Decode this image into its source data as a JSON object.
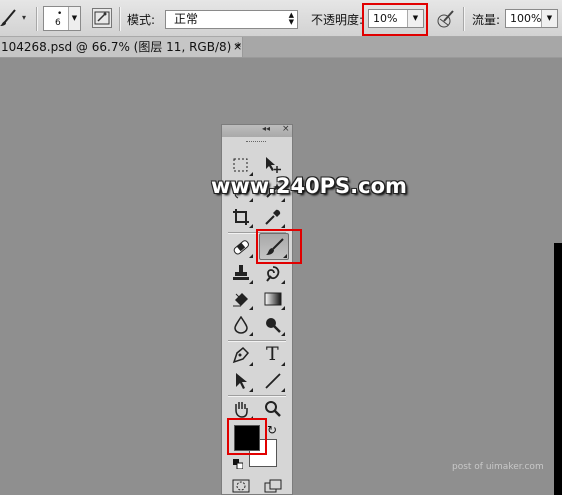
{
  "options_bar": {
    "tool_icon": "brush-icon",
    "brush_size": "6",
    "mode_label": "模式:",
    "mode_value": "正常",
    "opacity_label": "不透明度:",
    "opacity_value": "10%",
    "flow_label": "流量:",
    "flow_value": "100%"
  },
  "document_tab": {
    "title": "104268.psd @ 66.7% (图层 11, RGB/8) *",
    "close": "×"
  },
  "tools_panel": {
    "collapse": "◂◂",
    "close": "×",
    "tools": [
      {
        "name": "rect-marquee-tool",
        "icon": "marquee-icon"
      },
      {
        "name": "move-tool",
        "icon": "move-icon"
      },
      {
        "name": "lasso-tool",
        "icon": "lasso-icon"
      },
      {
        "name": "magic-wand-tool",
        "icon": "magic-wand-icon"
      },
      {
        "name": "crop-tool",
        "icon": "crop-icon"
      },
      {
        "name": "eyedropper-tool",
        "icon": "eyedropper-icon"
      },
      {
        "name": "healing-brush-tool",
        "icon": "bandage-icon"
      },
      {
        "name": "brush-tool",
        "icon": "brush-icon",
        "active": true
      },
      {
        "name": "clone-stamp-tool",
        "icon": "stamp-icon"
      },
      {
        "name": "history-brush-tool",
        "icon": "history-brush-icon"
      },
      {
        "name": "eraser-tool",
        "icon": "eraser-icon"
      },
      {
        "name": "gradient-tool",
        "icon": "gradient-icon"
      },
      {
        "name": "blur-tool",
        "icon": "drop-icon"
      },
      {
        "name": "dodge-tool",
        "icon": "dodge-icon"
      },
      {
        "name": "pen-tool",
        "icon": "pen-icon"
      },
      {
        "name": "type-tool",
        "icon": "type-icon",
        "glyph": "T"
      },
      {
        "name": "path-selection-tool",
        "icon": "arrow-icon"
      },
      {
        "name": "line-tool",
        "icon": "line-icon"
      },
      {
        "name": "hand-tool",
        "icon": "hand-icon"
      },
      {
        "name": "zoom-tool",
        "icon": "zoom-icon"
      },
      {
        "name": "quick-mask",
        "icon": "quick-mask-icon"
      },
      {
        "name": "screen-mode",
        "icon": "screen-mode-icon"
      }
    ],
    "foreground_color": "#000000",
    "background_color": "#ffffff"
  },
  "highlight_color": "#e10000",
  "watermark": "www.240PS.com",
  "footer": "post of uimaker.com"
}
